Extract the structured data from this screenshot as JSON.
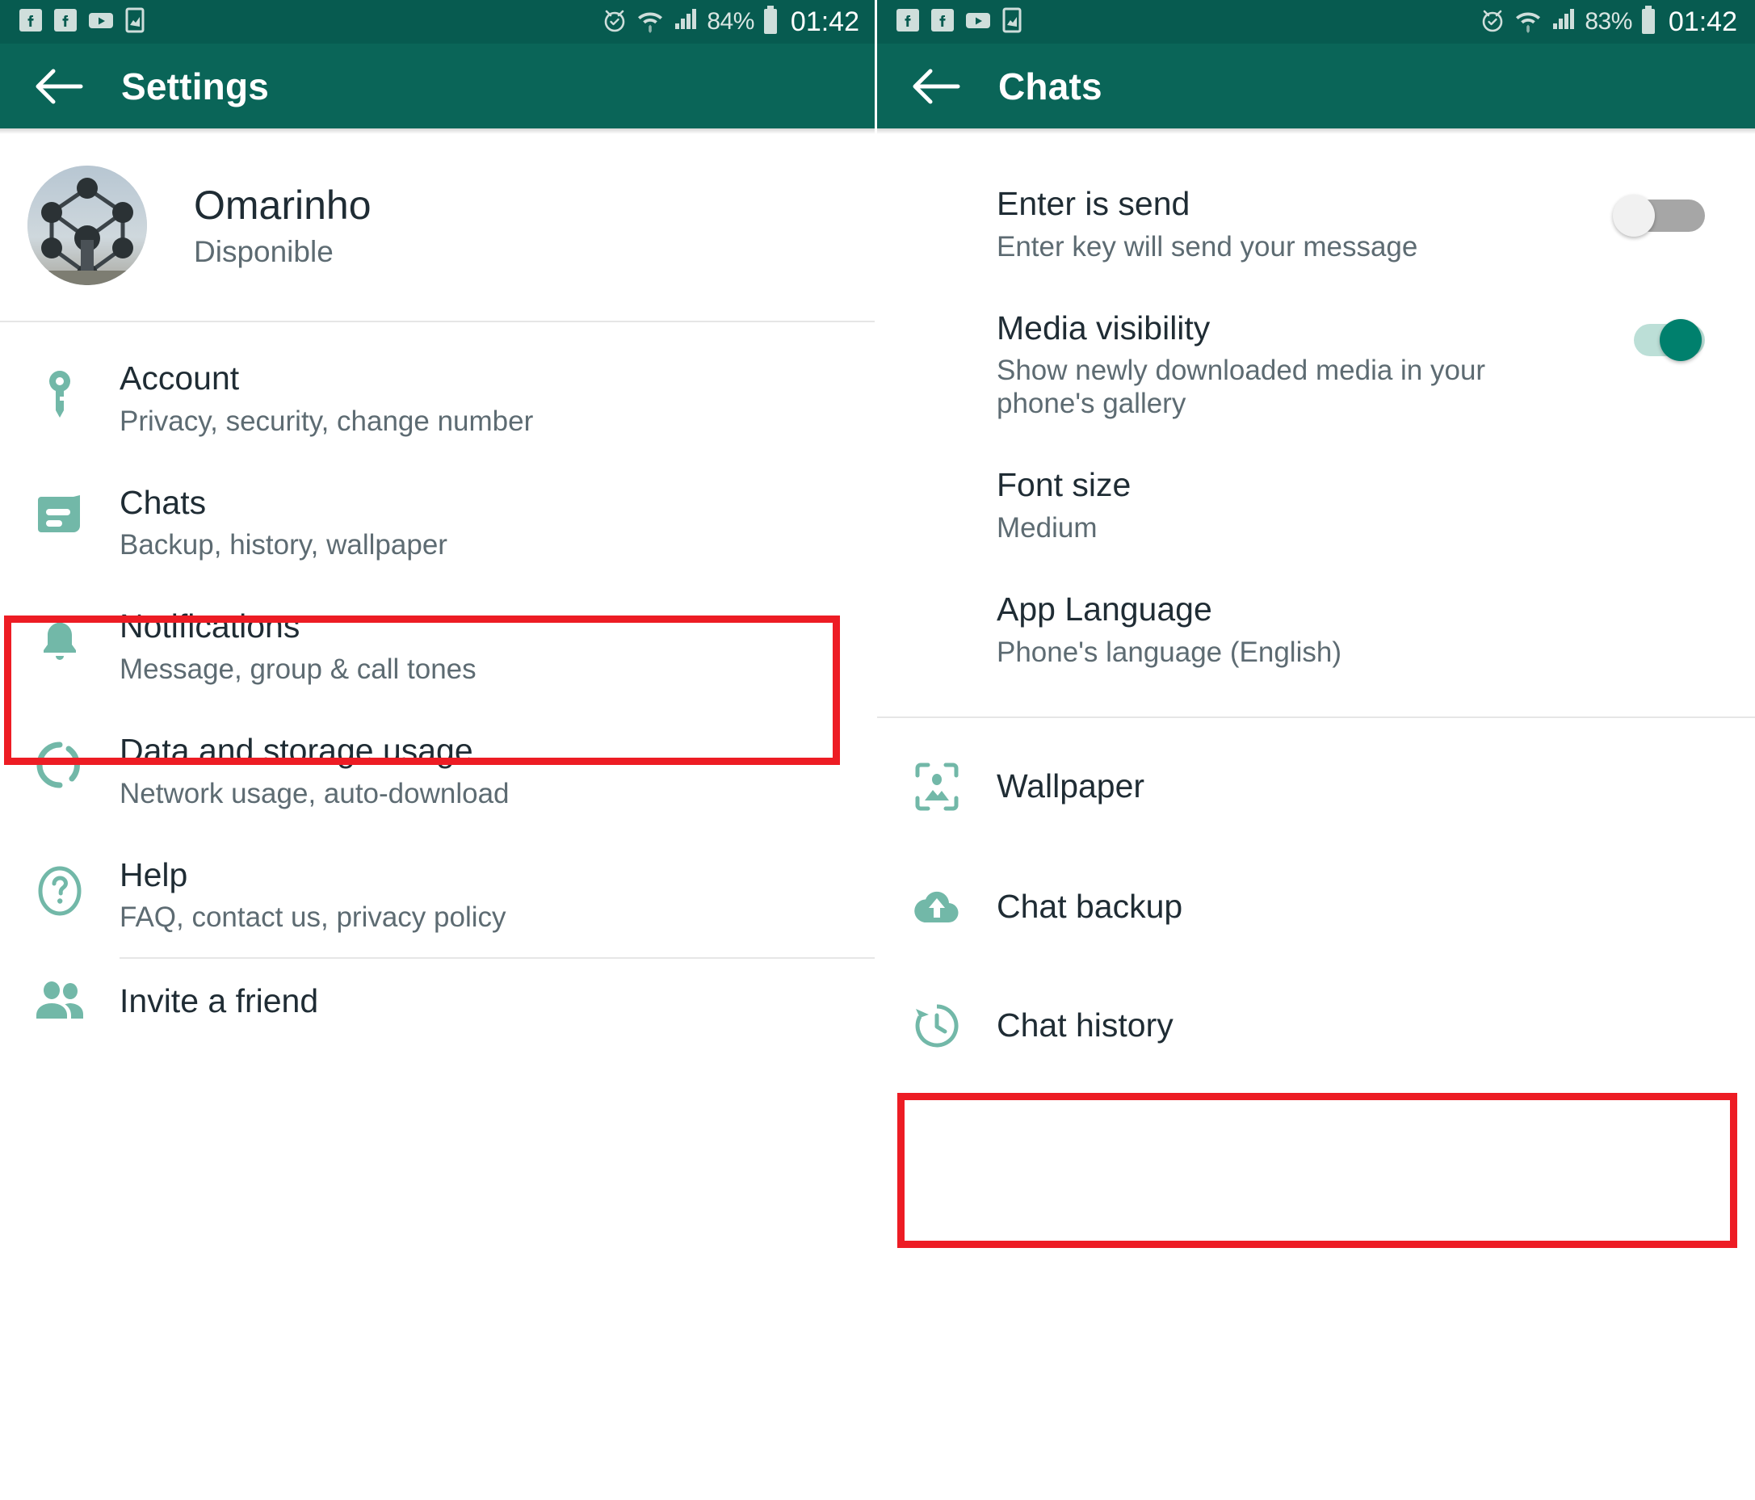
{
  "colors": {
    "statusbar_bg": "#075b50",
    "appbar_bg": "#0a6558",
    "accent_icon": "#72b8a8",
    "toggle_on": "#00806d",
    "toggle_off": "#a6a6a6",
    "highlight_red": "#ed1c24",
    "title_text": "#1f2c34",
    "subtitle_text": "#5d6b72"
  },
  "left_screen": {
    "statusbar": {
      "icons": [
        "facebook-icon",
        "facebook-icon",
        "youtube-icon",
        "app-icon"
      ],
      "right_icons": [
        "alarm-icon",
        "wifi-icon",
        "signal-icon"
      ],
      "battery_percent": "84%",
      "battery_icon": "battery-icon",
      "time": "01:42"
    },
    "appbar": {
      "back_icon": "back-arrow-icon",
      "title": "Settings"
    },
    "profile": {
      "avatar_icon": "profile-avatar",
      "name": "Omarinho",
      "status": "Disponible"
    },
    "items": [
      {
        "icon": "key-icon",
        "title": "Account",
        "subtitle": "Privacy, security, change number",
        "highlighted": false
      },
      {
        "icon": "chat-bubble-icon",
        "title": "Chats",
        "subtitle": "Backup, history, wallpaper",
        "highlighted": true
      },
      {
        "icon": "bell-icon",
        "title": "Notifications",
        "subtitle": "Message, group & call tones",
        "highlighted": false
      },
      {
        "icon": "data-usage-icon",
        "title": "Data and storage usage",
        "subtitle": "Network usage, auto-download",
        "highlighted": false
      },
      {
        "icon": "help-circle-icon",
        "title": "Help",
        "subtitle": "FAQ, contact us, privacy policy",
        "highlighted": false
      }
    ],
    "footer_items": [
      {
        "icon": "people-icon",
        "title": "Invite a friend"
      }
    ]
  },
  "right_screen": {
    "statusbar": {
      "icons": [
        "facebook-icon",
        "facebook-icon",
        "youtube-icon",
        "app-icon"
      ],
      "right_icons": [
        "alarm-icon",
        "wifi-icon",
        "signal-icon"
      ],
      "battery_percent": "83%",
      "battery_icon": "battery-icon",
      "time": "01:42"
    },
    "appbar": {
      "back_icon": "back-arrow-icon",
      "title": "Chats"
    },
    "settings_group": [
      {
        "title": "Enter is send",
        "subtitle": "Enter key will send your message",
        "control": "toggle",
        "toggle_state": "off"
      },
      {
        "title": "Media visibility",
        "subtitle": "Show newly downloaded media in your phone's gallery",
        "control": "toggle",
        "toggle_state": "on"
      },
      {
        "title": "Font size",
        "subtitle": "Medium",
        "control": "none"
      },
      {
        "title": "App Language",
        "subtitle": "Phone's language (English)",
        "control": "none"
      }
    ],
    "actions_group": [
      {
        "icon": "wallpaper-icon",
        "title": "Wallpaper",
        "highlighted": false
      },
      {
        "icon": "cloud-upload-icon",
        "title": "Chat backup",
        "highlighted": true
      },
      {
        "icon": "history-clock-icon",
        "title": "Chat history",
        "highlighted": false
      }
    ]
  }
}
